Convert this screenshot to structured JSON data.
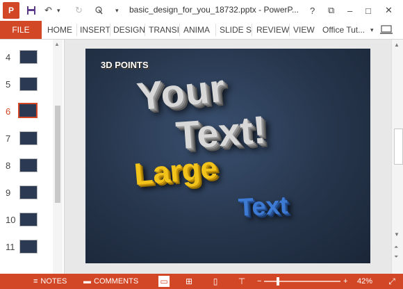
{
  "titlebar": {
    "app_icon": "P",
    "title": "basic_design_for_you_18732.pptx - PowerP...",
    "buttons": [
      "save-icon",
      "undo-icon",
      "undo-dropdown-icon",
      "redo-icon",
      "touch-mode-icon",
      "customize-dropdown-icon"
    ],
    "help": "?",
    "restore": "⧉",
    "minimize": "–",
    "maximize": "□",
    "close": "✕"
  },
  "ribbon": {
    "file": "FILE",
    "tabs": [
      "HOME",
      "INSERT",
      "DESIGN",
      "TRANSI",
      "ANIMA",
      "SLIDE S",
      "REVIEW",
      "VIEW"
    ],
    "account": "Office Tut...",
    "account_dropdown": "▾"
  },
  "thumbnails": {
    "items": [
      {
        "num": "4",
        "active": false
      },
      {
        "num": "5",
        "active": false
      },
      {
        "num": "6",
        "active": true
      },
      {
        "num": "7",
        "active": false
      },
      {
        "num": "8",
        "active": false
      },
      {
        "num": "9",
        "active": false
      },
      {
        "num": "10",
        "active": false
      },
      {
        "num": "11",
        "active": false
      }
    ]
  },
  "slide": {
    "label": "3D POINTS",
    "line1": "Your",
    "line2": "Text!",
    "line3": "Large",
    "line4": "Text"
  },
  "statusbar": {
    "notes": "NOTES",
    "comments": "COMMENTS",
    "zoom": "42%",
    "minus": "−",
    "plus": "+"
  },
  "colors": {
    "accent": "#d24726",
    "slide_bg": "#26354b"
  }
}
